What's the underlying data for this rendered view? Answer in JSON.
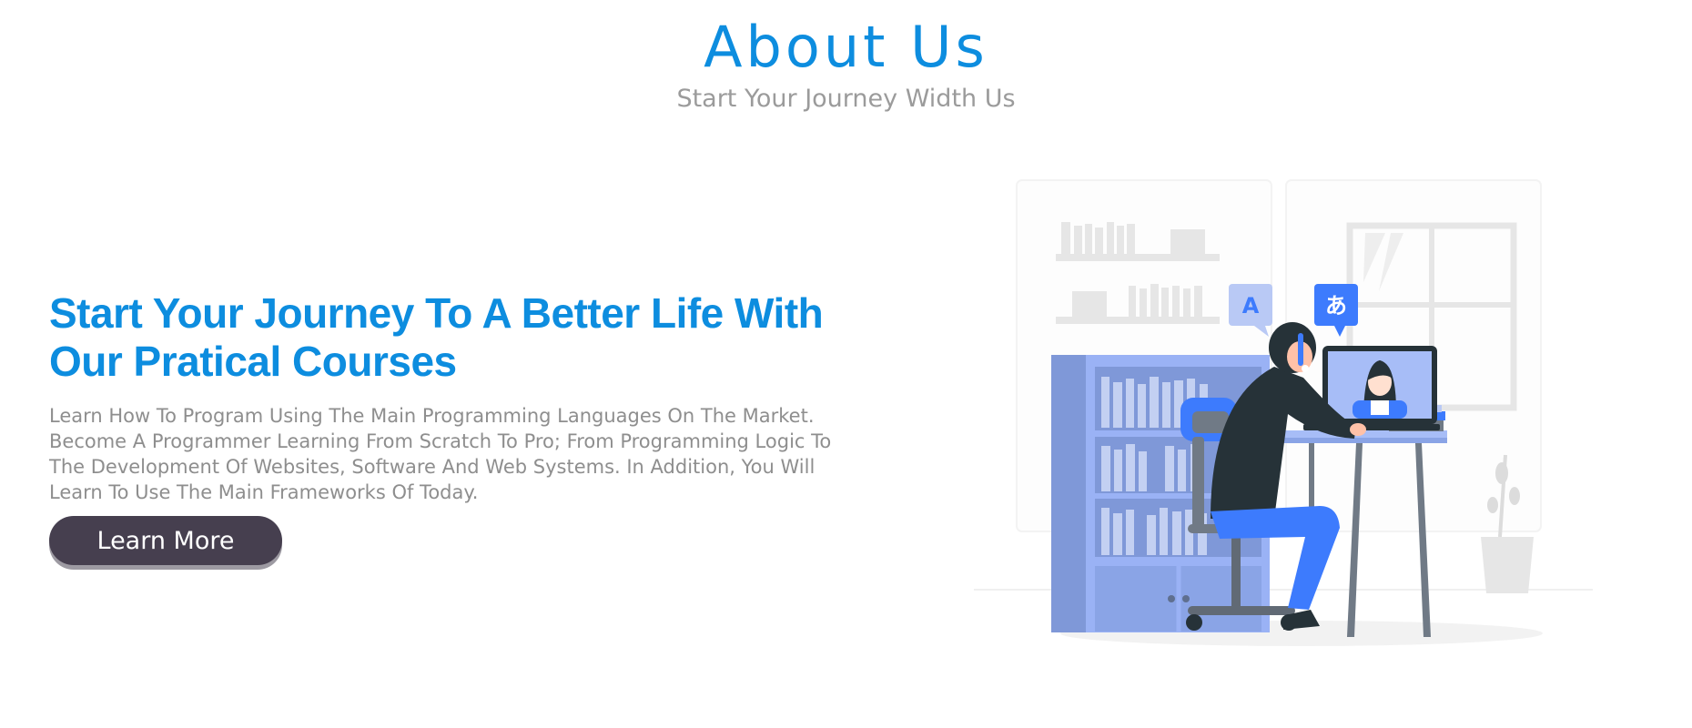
{
  "about": {
    "title": "About Us",
    "subtitle": "Start Your Journey Width Us"
  },
  "content": {
    "headline": "Start Your Journey To A Better Life With Our Pratical Courses",
    "description": "Learn How To Program Using The Main Programming Languages On The Market. Become A Programmer Learning From Scratch To Pro; From Programming Logic To The Development Of Websites, Software And Web Systems. In Addition, You Will Learn To Use The Main Frameworks Of Today.",
    "button_label": "Learn More"
  },
  "illustration": {
    "bubble_left_text": "A",
    "bubble_right_text": "あ",
    "icon": "online-learning-illustration"
  },
  "colors": {
    "accent": "#0d8ddf",
    "button_bg": "#463f4f",
    "muted_text": "#9b9b9b",
    "illustration_blue": "#3d7bfd"
  }
}
